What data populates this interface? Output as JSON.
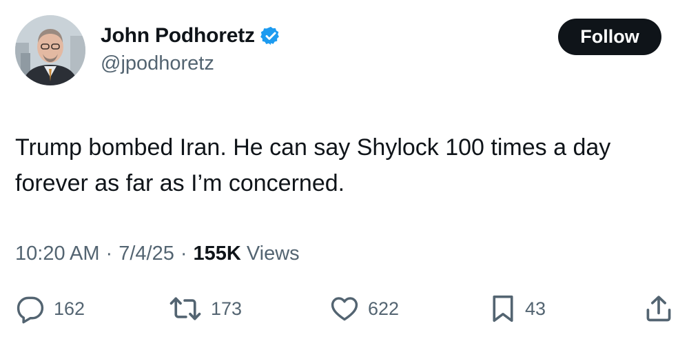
{
  "author": {
    "display_name": "John Podhoretz",
    "handle": "@jpodhoretz",
    "verified": true
  },
  "follow_label": "Follow",
  "tweet": {
    "text": "Trump bombed Iran. He can say Shylock 100 times a day forever as far as I’m concerned."
  },
  "meta": {
    "time": "10:20 AM",
    "date": "7/4/25",
    "views_count": "155K",
    "views_label": "Views",
    "separator": "·"
  },
  "actions": {
    "replies": "162",
    "reposts": "173",
    "likes": "622",
    "bookmarks": "43"
  },
  "colors": {
    "text_primary": "#0f1419",
    "text_secondary": "#536471",
    "verified_blue": "#1d9bf0",
    "button_bg": "#0f1419"
  },
  "icons": [
    "verified-badge-icon",
    "reply-icon",
    "repost-icon",
    "like-icon",
    "bookmark-icon",
    "share-icon"
  ]
}
